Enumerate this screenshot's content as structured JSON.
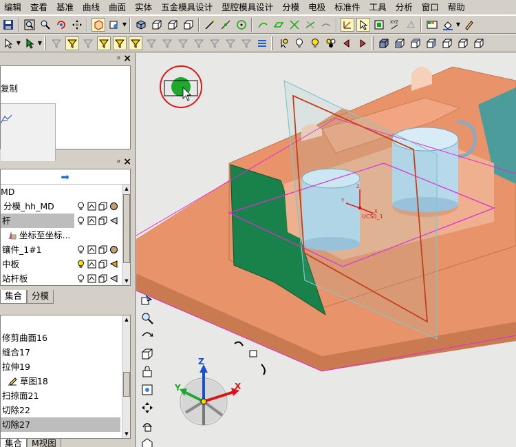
{
  "menu": [
    "编辑",
    "查看",
    "基准",
    "曲线",
    "曲面",
    "实体",
    "五金模具设计",
    "型腔模具设计",
    "分模",
    "电极",
    "标准件",
    "工具",
    "分析",
    "窗口",
    "帮助"
  ],
  "panel1": {
    "label": "复制"
  },
  "panel2": {
    "items": [
      {
        "label": "MD"
      },
      {
        "label": "分模_hh_MD"
      },
      {
        "label": "杆"
      },
      {
        "label": "坐标至坐标..."
      },
      {
        "label": "镶件_1#1"
      },
      {
        "label": "中板"
      },
      {
        "label": "站杆板"
      }
    ],
    "tabs": [
      "集合",
      "分模"
    ]
  },
  "panel3": {
    "items": [
      {
        "label": "修剪曲面16"
      },
      {
        "label": "缝合17"
      },
      {
        "label": "拉伸19"
      },
      {
        "label": "草图18"
      },
      {
        "label": "扫掠面21"
      },
      {
        "label": "切除22"
      },
      {
        "label": "切除27"
      }
    ],
    "tabs": [
      "集合",
      "M视图"
    ]
  },
  "viewport": {
    "csys_label": "UCS0_1",
    "csys_x": "X",
    "csys_y": "Y",
    "csys_z": "Z",
    "triad": {
      "x": "X",
      "y": "Y",
      "z": "Z"
    }
  },
  "colors": {
    "part": "#e8936a",
    "part_dark": "#c2764e",
    "green_face": "#18824a",
    "teal_face": "#4b9c9a",
    "cup": "#b8d8ec",
    "plane_orange": "#c2401a",
    "plane_cyan": "#7fc8c8",
    "plane_magenta": "#e02ad8",
    "marker_red": "#d81818",
    "marker_green": "#1fa830"
  }
}
